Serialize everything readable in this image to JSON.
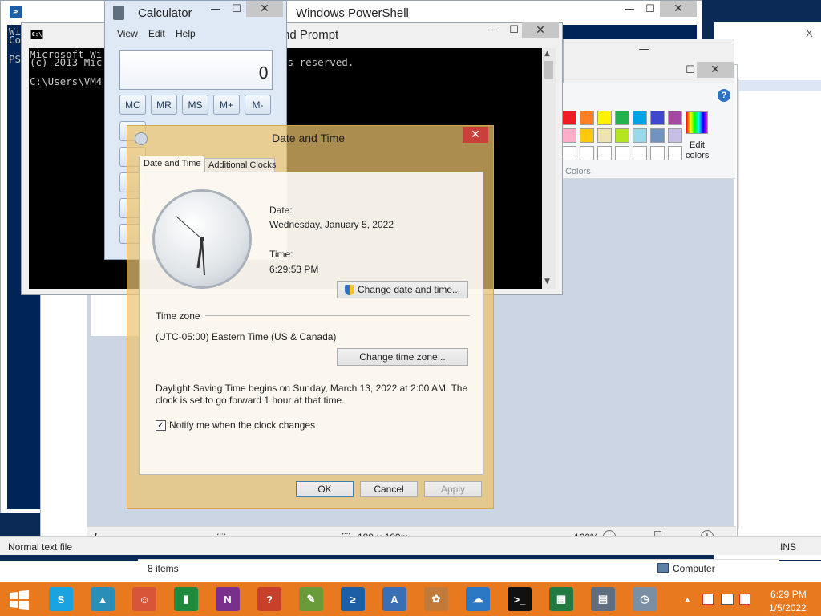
{
  "desktop_color": "#0b2a55",
  "powershell": {
    "title": "Windows PowerShell",
    "close_glyph": "✕",
    "min_glyph": "—",
    "max_glyph": "☐",
    "fragment1": "Wi",
    "fragment2": "Co",
    "fragment3": "PS"
  },
  "cmd": {
    "title": "nd Prompt",
    "line1": "Microsoft Wi",
    "line2": "(c) 2013 Mic",
    "line2b": "ts reserved.",
    "line3": "C:\\Users\\VM4"
  },
  "calculator": {
    "title": "Calculator",
    "menu": [
      "View",
      "Edit",
      "Help"
    ],
    "display": "0",
    "memory_buttons": [
      "MC",
      "MR",
      "MS",
      "M+",
      "M-"
    ]
  },
  "paint": {
    "edit_colors_line1": "Edit",
    "edit_colors_line2": "colors",
    "colors_label": "Colors",
    "help_glyph": "?",
    "zoom": "100%",
    "dimensions": "189 × 189px",
    "minus": "−",
    "plus": "+"
  },
  "notepad": {
    "status": "Normal text file",
    "ins": "INS",
    "close_glyph": "X"
  },
  "explorer": {
    "items": "8 items",
    "computer": "Computer"
  },
  "datetime": {
    "title": "Date and Time",
    "tabs": [
      "Date and Time",
      "Additional Clocks"
    ],
    "date_label": "Date:",
    "date_value": "Wednesday, January 5, 2022",
    "time_label": "Time:",
    "time_value": "6:29:53 PM",
    "change_datetime": "Change date and time...",
    "timezone_header": "Time zone",
    "timezone_value": "(UTC-05:00) Eastern Time (US & Canada)",
    "change_timezone": "Change time zone...",
    "dst_line1": "Daylight Saving Time begins on Sunday, March 13, 2022 at 2:00 AM. The",
    "dst_line2": "clock is set to go forward 1 hour at that time.",
    "notify": "Notify me when the clock changes",
    "notify_checked": true,
    "ok": "OK",
    "cancel": "Cancel",
    "apply": "Apply",
    "close_glyph": "✕",
    "check_glyph": "✓"
  },
  "taskbar": {
    "color": "#e8791e",
    "clock_time": "6:29 PM",
    "clock_date": "1/5/2022",
    "tray_up": "▲",
    "apps": [
      {
        "name": "skype",
        "glyph": "S",
        "color": "#1aa3e0"
      },
      {
        "name": "photo",
        "glyph": "▲",
        "color": "#2a8fb8"
      },
      {
        "name": "people",
        "glyph": "☺",
        "color": "#d9553a"
      },
      {
        "name": "finance",
        "glyph": "▮",
        "color": "#1e8a3c"
      },
      {
        "name": "onenote",
        "glyph": "N",
        "color": "#7a2f8d"
      },
      {
        "name": "help",
        "glyph": "?",
        "color": "#c8402c"
      },
      {
        "name": "notepadpp",
        "glyph": "✎",
        "color": "#6a9b3a"
      },
      {
        "name": "powershell",
        "glyph": "≥",
        "color": "#1c5fa6"
      },
      {
        "name": "wordpad",
        "glyph": "A",
        "color": "#3b6fb5"
      },
      {
        "name": "paint",
        "glyph": "✿",
        "color": "#c27a3a"
      },
      {
        "name": "onedrive",
        "glyph": "☁",
        "color": "#2c77c4"
      },
      {
        "name": "cmd",
        "glyph": ">_",
        "color": "#111111"
      },
      {
        "name": "excel",
        "glyph": "▦",
        "color": "#207a41"
      },
      {
        "name": "calculator",
        "glyph": "▤",
        "color": "#5f6f80"
      },
      {
        "name": "datetime",
        "glyph": "◷",
        "color": "#7a8fa3"
      }
    ]
  }
}
